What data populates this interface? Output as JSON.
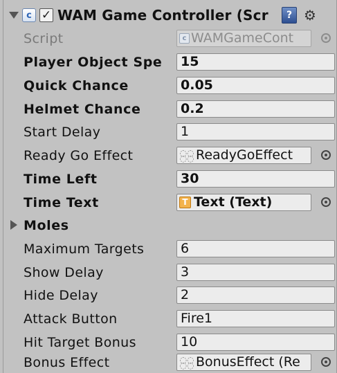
{
  "component": {
    "title": "WAM Game Controller (Scr",
    "enabled": true,
    "check_glyph": "✓",
    "script_glyph": "c",
    "help_glyph": "?",
    "gear_glyph": "⚙"
  },
  "fields": {
    "script": {
      "label": "Script",
      "value": "WAMGameCont",
      "icon": "cs-script-icon"
    },
    "player_object_speed": {
      "label": "Player Object Spe",
      "value": "15"
    },
    "quick_chance": {
      "label": "Quick Chance",
      "value": "0.05"
    },
    "helmet_chance": {
      "label": "Helmet Chance",
      "value": "0.2"
    },
    "start_delay": {
      "label": "Start Delay",
      "value": "1"
    },
    "ready_go_effect": {
      "label": "Ready Go Effect",
      "value": "ReadyGoEffect",
      "icon": "prefab-icon"
    },
    "time_left": {
      "label": "Time Left",
      "value": "30"
    },
    "time_text": {
      "label": "Time Text",
      "value": "Text (Text)",
      "icon": "text-component-icon",
      "icon_glyph": "T"
    },
    "moles": {
      "label": "Moles",
      "expanded": false
    },
    "maximum_targets": {
      "label": "Maximum Targets",
      "value": "6"
    },
    "show_delay": {
      "label": "Show Delay",
      "value": "3"
    },
    "hide_delay": {
      "label": "Hide Delay",
      "value": "2"
    },
    "attack_button": {
      "label": "Attack Button",
      "value": "Fire1"
    },
    "hit_target_bonus": {
      "label": "Hit Target Bonus",
      "value": "10"
    },
    "bonus_effect": {
      "label": "Bonus Effect",
      "value": "BonusEffect (Re",
      "icon": "prefab-icon"
    }
  },
  "colors": {
    "panel_bg": "#c2c2c2",
    "field_bg": "#ececec",
    "text_icon": "#f3b34d",
    "help_icon": "#2d4f91"
  }
}
